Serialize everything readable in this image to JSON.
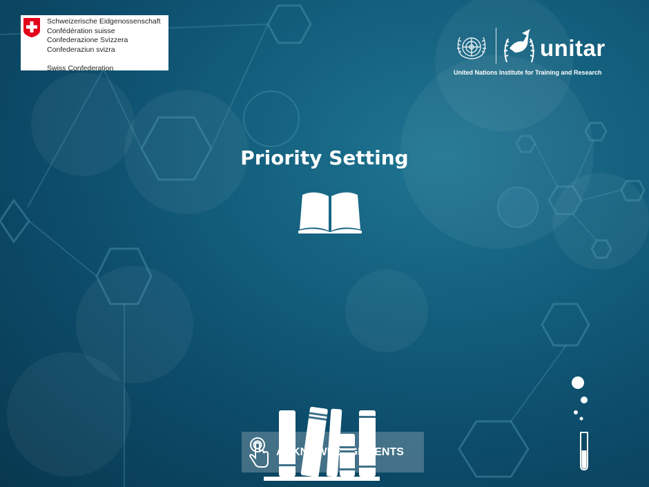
{
  "sponsor": {
    "lines": [
      "Schweizerische Eidgenossenschaft",
      "Confédération suisse",
      "Confederazione Svizzera",
      "Confederaziun svizra"
    ],
    "english": "Swiss Confederation"
  },
  "partner": {
    "wordmark": "unitar",
    "tagline": "United Nations Institute for Training and Research"
  },
  "page": {
    "title": "Priority Setting"
  },
  "footer": {
    "acknowledgements_label": "ACKNOWLEDGEMENTS"
  },
  "icons": [
    "swiss-flag-icon",
    "un-emblem-icon",
    "unitar-bird-icon",
    "open-book-icon",
    "touch-icon",
    "books-icon",
    "test-tube-icon"
  ],
  "colors": {
    "background": "#14617f",
    "text": "#ffffff",
    "swiss_red": "#e3001b"
  }
}
